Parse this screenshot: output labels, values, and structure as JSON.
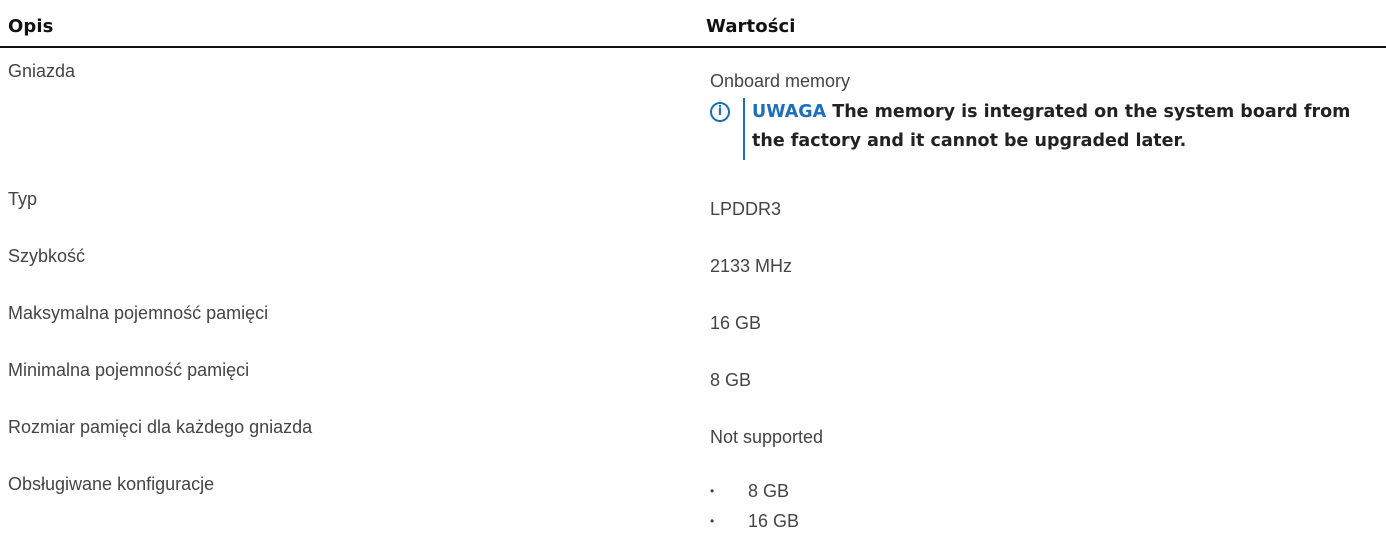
{
  "table": {
    "headers": {
      "description": "Opis",
      "value": "Wartości"
    },
    "rows": [
      {
        "label": "Gniazda",
        "value": "Onboard memory",
        "note": {
          "tag": "UWAGA",
          "text": "The memory is integrated on the system board from the factory and it cannot be upgraded later.",
          "icon": "info-icon",
          "color": "#1c6fb8"
        }
      },
      {
        "label": "Typ",
        "value": "LPDDR3"
      },
      {
        "label": "Szybkość",
        "value": "2133 MHz"
      },
      {
        "label": "Maksymalna pojemność pamięci",
        "value": "16 GB"
      },
      {
        "label": "Minimalna pojemność pamięci",
        "value": "8 GB"
      },
      {
        "label": "Rozmiar pamięci dla każdego gniazda",
        "value": "Not supported"
      },
      {
        "label": "Obsługiwane konfiguracje",
        "items": [
          "8 GB",
          "16 GB"
        ]
      }
    ]
  }
}
